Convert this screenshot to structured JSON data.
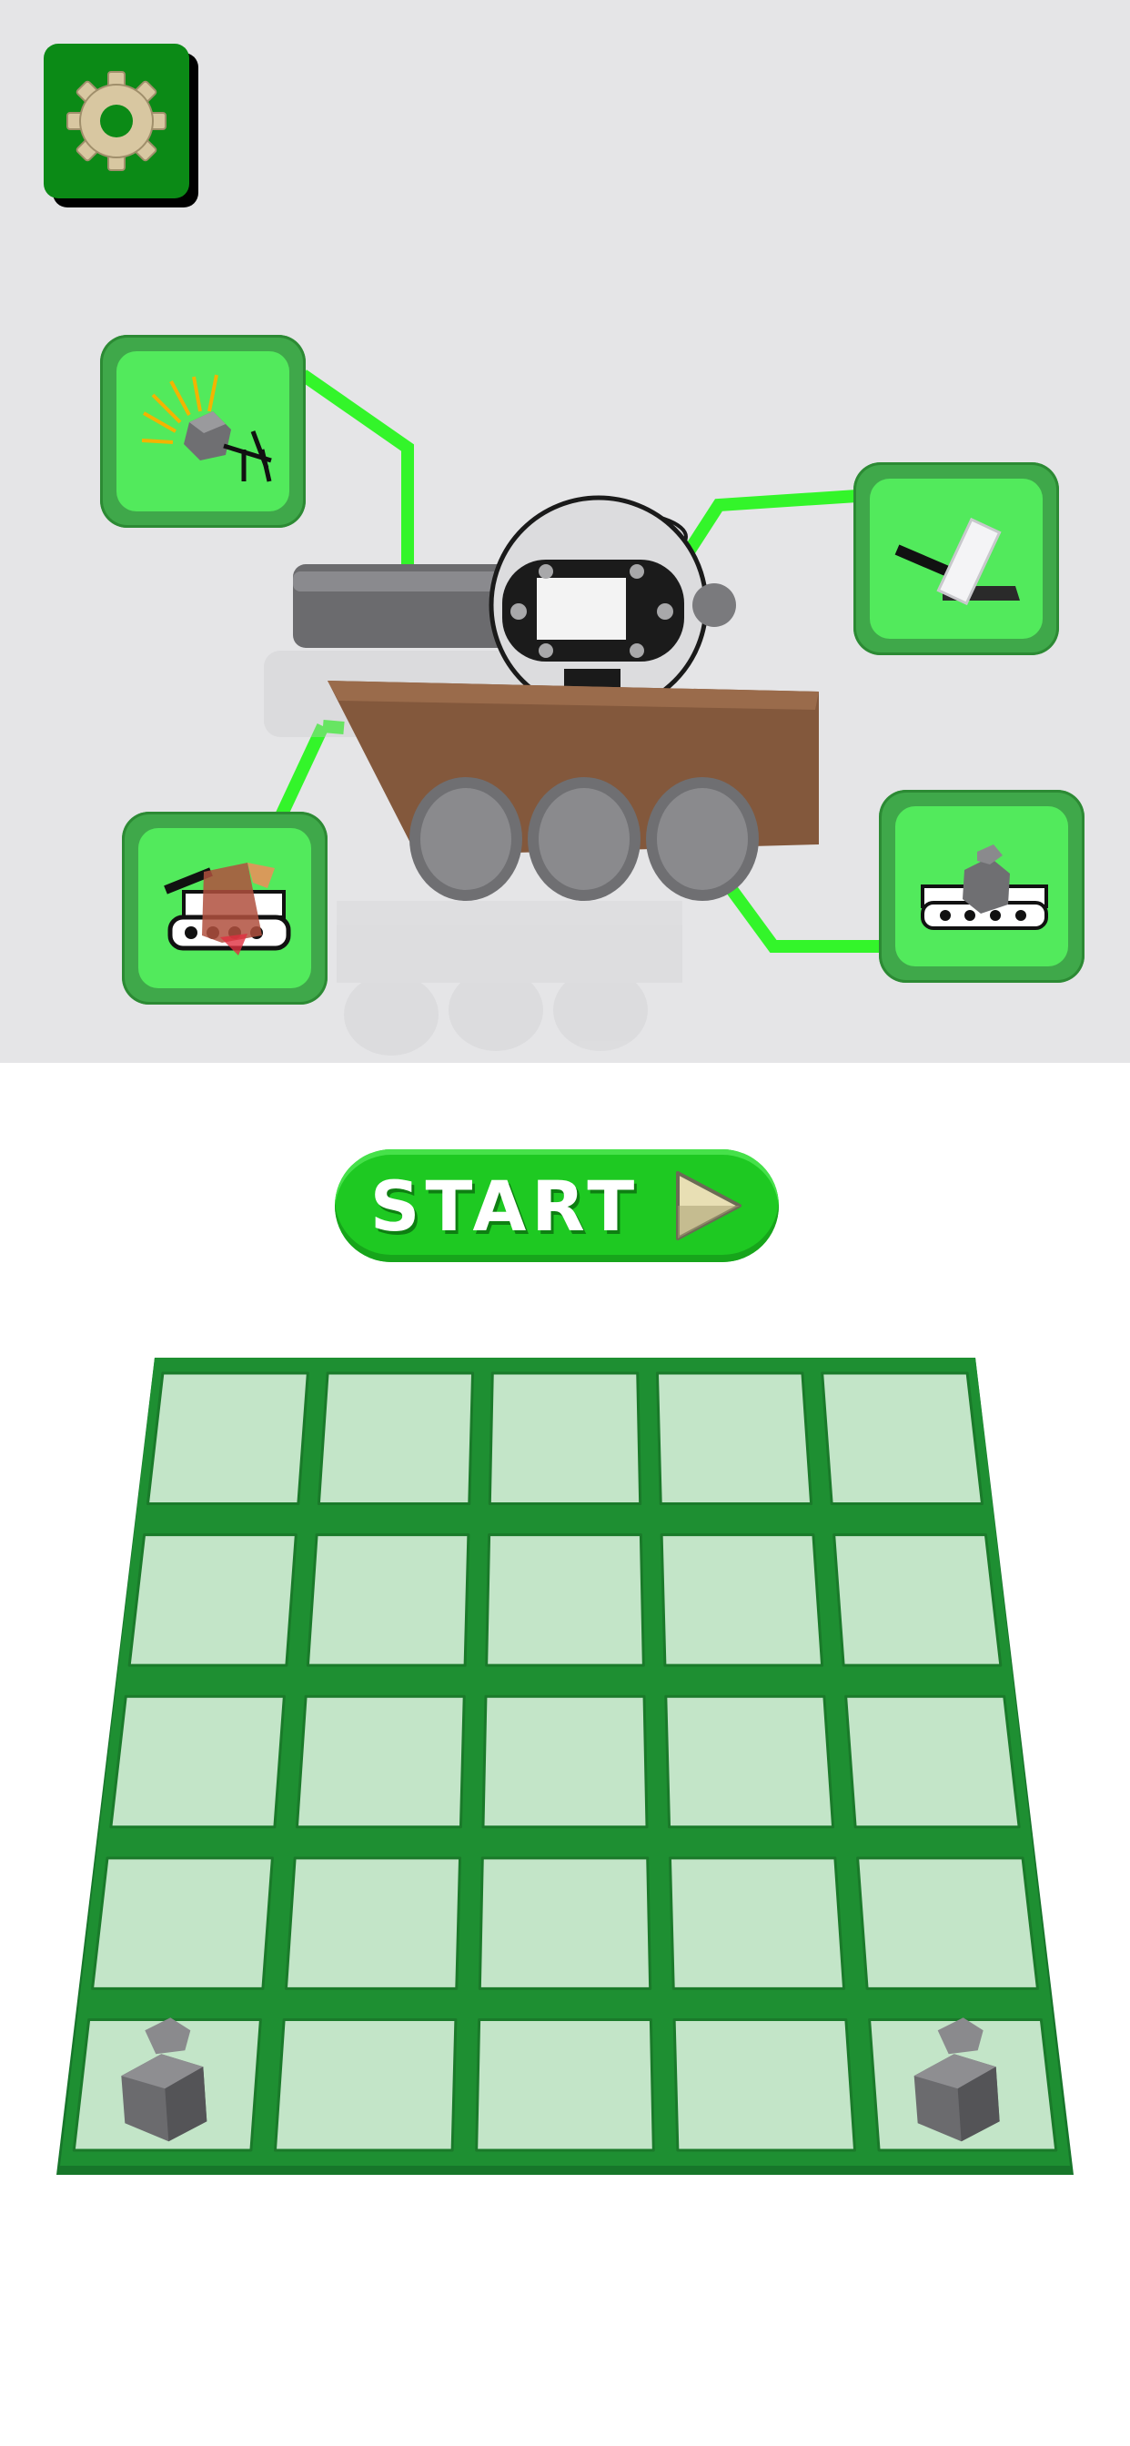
{
  "header": {
    "settings_icon": "gear-icon"
  },
  "upgrades": [
    {
      "slot": "top-left",
      "icon": "bomb-launcher-icon"
    },
    {
      "slot": "top-right",
      "icon": "blade-weapon-icon"
    },
    {
      "slot": "bottom-left",
      "icon": "armor-tank-icon"
    },
    {
      "slot": "bottom-right",
      "icon": "rock-tank-icon"
    }
  ],
  "start_button": {
    "label": "START",
    "icon": "play-triangle-icon"
  },
  "merge_grid": {
    "rows": 5,
    "cols": 5,
    "items": [
      {
        "row": 5,
        "col": 1,
        "type": "rock-block"
      },
      {
        "row": 5,
        "col": 5,
        "type": "rock-block"
      }
    ]
  },
  "colors": {
    "scene_background": "#e5e5e7",
    "accent_green": "#1ec922",
    "wire_green": "#33f52a",
    "grid_frame": "#1e8f32",
    "grid_cell": "#c3e5c8"
  }
}
